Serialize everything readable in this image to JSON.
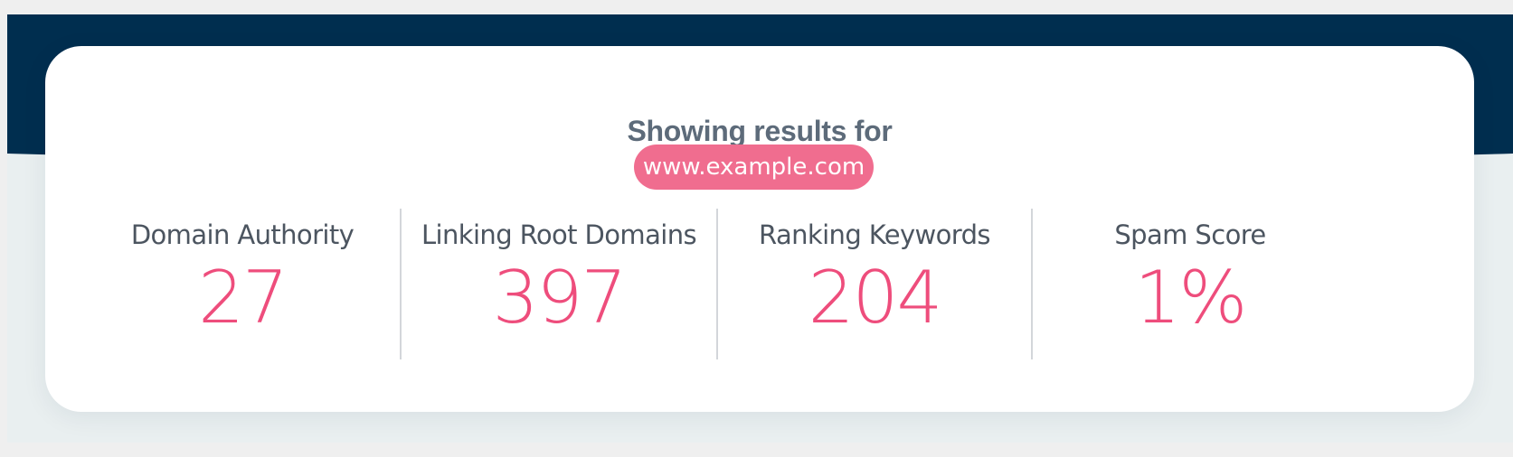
{
  "header": {
    "title": "Showing results for",
    "domain": "www.example.com"
  },
  "metrics": [
    {
      "label": "Domain Authority",
      "value": "27"
    },
    {
      "label": "Linking Root Domains",
      "value": "397"
    },
    {
      "label": "Ranking Keywords",
      "value": "204"
    },
    {
      "label": "Spam Score",
      "value": "1%"
    }
  ],
  "colors": {
    "banner": "#002e4f",
    "accent": "#ee4d7c",
    "pill": "#f06d8f",
    "heading": "#5d6b7a",
    "label": "#4c5560",
    "card": "#ffffff",
    "background": "#e9eff0"
  }
}
